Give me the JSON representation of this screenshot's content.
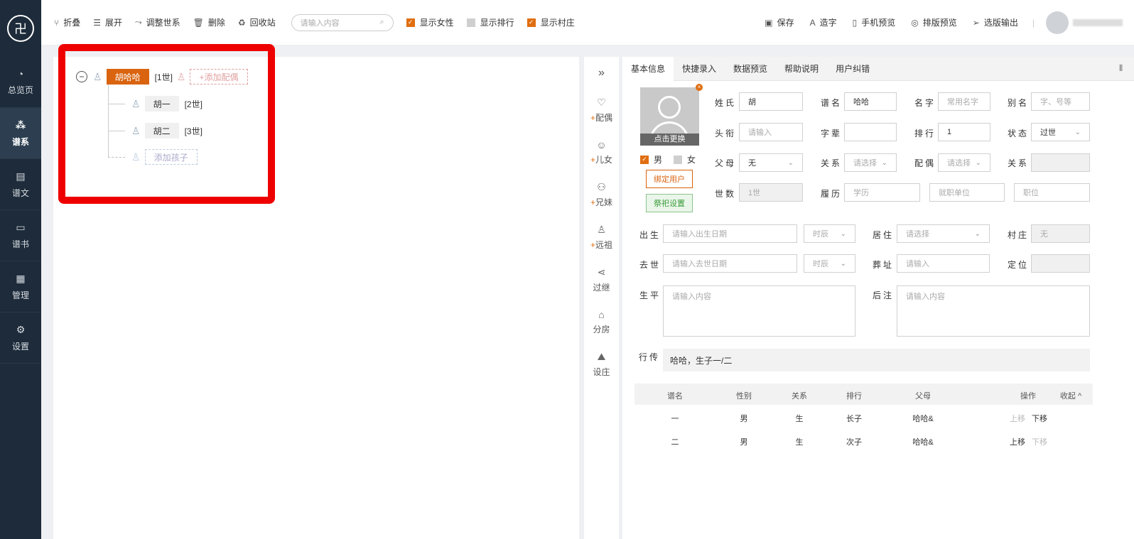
{
  "sidebar": {
    "logo": "卍",
    "items": [
      {
        "label": "总览页",
        "icon": "◔"
      },
      {
        "label": "谱系",
        "icon": "⁂"
      },
      {
        "label": "谱文",
        "icon": "▤"
      },
      {
        "label": "谱书",
        "icon": "▭"
      },
      {
        "label": "管理",
        "icon": "▦"
      },
      {
        "label": "设置",
        "icon": "⚙"
      }
    ]
  },
  "toolbar": {
    "collapse": "折叠",
    "expand": "展开",
    "adjust": "调整世系",
    "delete": "删除",
    "recycle": "回收站",
    "search_placeholder": "请输入内容",
    "show_female": "显示女性",
    "show_rank": "显示排行",
    "show_village": "显示村庄",
    "save": "保存",
    "font": "造字",
    "mobile_preview": "手机预览",
    "layout_preview": "排版预览",
    "export": "选版输出"
  },
  "tree": {
    "root": {
      "name": "胡哈哈",
      "gen": "[1世]",
      "add_spouse": "+添加配偶"
    },
    "children": [
      {
        "name": "胡一",
        "gen": "[2世]"
      },
      {
        "name": "胡二",
        "gen": "[3世]"
      }
    ],
    "add_child": "添加孩子"
  },
  "actions": [
    {
      "label": "配偶",
      "plus": "+",
      "icon": "♡"
    },
    {
      "label": "儿女",
      "plus": "+",
      "icon": "☺"
    },
    {
      "label": "兄妹",
      "plus": "+",
      "icon": "⚇"
    },
    {
      "label": "远祖",
      "plus": "+",
      "icon": "♙"
    },
    {
      "label": "过继",
      "plus": "",
      "icon": "⋖"
    },
    {
      "label": "分房",
      "plus": "",
      "icon": "⌂"
    },
    {
      "label": "设庄",
      "plus": "",
      "icon": "⛰"
    }
  ],
  "tabs": [
    "基本信息",
    "快捷录入",
    "数据预览",
    "帮助说明",
    "用户纠错"
  ],
  "photo": {
    "change": "点击更换",
    "male": "男",
    "female": "女",
    "bind_user": "绑定用户",
    "sacrifice": "祭祀设置"
  },
  "form": {
    "surname_l": "姓氏",
    "surname": "胡",
    "puname_l": "谱名",
    "puname": "哈哈",
    "name_l": "名字",
    "name_ph": "常用名字",
    "alias_l": "别名",
    "alias_ph": "字、号等",
    "title_l": "头衔",
    "title_ph": "请输入",
    "zibei_l": "字辈",
    "rank_l": "排行",
    "rank": "1",
    "status_l": "状态",
    "status": "过世",
    "parent_l": "父母",
    "parent": "无",
    "rel_l": "关系",
    "rel_ph": "请选择",
    "spouse_l": "配偶",
    "spouse_ph": "请选择",
    "rel2_l": "关系",
    "gen_l": "世数",
    "gen": "1世",
    "resume_l": "履历",
    "edu_ph": "学历",
    "work_ph": "就职单位",
    "pos_ph": "职位",
    "birth_l": "出生",
    "birth_ph": "请输入出生日期",
    "hour_ph": "时辰",
    "home_l": "居住",
    "home_ph": "请选择",
    "village_l": "村庄",
    "village": "无",
    "death_l": "去世",
    "death_ph": "请输入去世日期",
    "burial_l": "葬址",
    "burial_ph": "请输入",
    "locate_l": "定位",
    "life_l": "生平",
    "life_ph": "请输入内容",
    "note_l": "后注",
    "note_ph": "请输入内容",
    "bio_l": "行传",
    "bio": "哈哈，生子一/二"
  },
  "table": {
    "headers": [
      "谱名",
      "性别",
      "关系",
      "排行",
      "父母",
      "操作",
      "收起 ^"
    ],
    "rows": [
      {
        "name": "一",
        "sex": "男",
        "rel": "生",
        "rank": "长子",
        "parent": "哈哈&",
        "up": "上移",
        "down": "下移"
      },
      {
        "name": "二",
        "sex": "男",
        "rel": "生",
        "rank": "次子",
        "parent": "哈哈&",
        "up": "上移",
        "down": "下移"
      }
    ]
  }
}
